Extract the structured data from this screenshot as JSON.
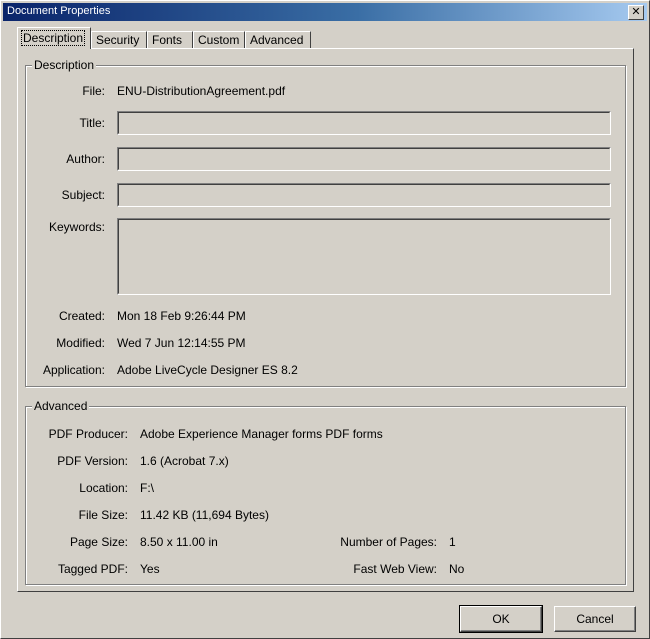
{
  "window": {
    "title": "Document Properties",
    "close_glyph": "✕"
  },
  "tabs": [
    {
      "label": "Description",
      "active": true
    },
    {
      "label": "Security"
    },
    {
      "label": "Fonts"
    },
    {
      "label": "Custom"
    },
    {
      "label": "Advanced"
    }
  ],
  "description": {
    "legend": "Description",
    "file_label": "File:",
    "file_value": "ENU-DistributionAgreement.pdf",
    "title_label": "Title:",
    "title_value": "",
    "author_label": "Author:",
    "author_value": "",
    "subject_label": "Subject:",
    "subject_value": "",
    "keywords_label": "Keywords:",
    "keywords_value": "",
    "created_label": "Created:",
    "created_value": "Mon 18 Feb 9:26:44 PM",
    "modified_label": "Modified:",
    "modified_value": "Wed 7 Jun 12:14:55 PM",
    "application_label": "Application:",
    "application_value": "Adobe LiveCycle Designer ES 8.2"
  },
  "advanced": {
    "legend": "Advanced",
    "producer_label": "PDF Producer:",
    "producer_value": "Adobe Experience Manager forms PDF forms",
    "version_label": "PDF Version:",
    "version_value": "1.6 (Acrobat 7.x)",
    "location_label": "Location:",
    "location_value": "F:\\",
    "filesize_label": "File Size:",
    "filesize_value": "11.42 KB (11,694 Bytes)",
    "pagesize_label": "Page Size:",
    "pagesize_value": "8.50 x 11.00 in",
    "numpages_label": "Number of Pages:",
    "numpages_value": "1",
    "tagged_label": "Tagged PDF:",
    "tagged_value": "Yes",
    "fastweb_label": "Fast Web View:",
    "fastweb_value": "No"
  },
  "buttons": {
    "ok": "OK",
    "cancel": "Cancel"
  }
}
